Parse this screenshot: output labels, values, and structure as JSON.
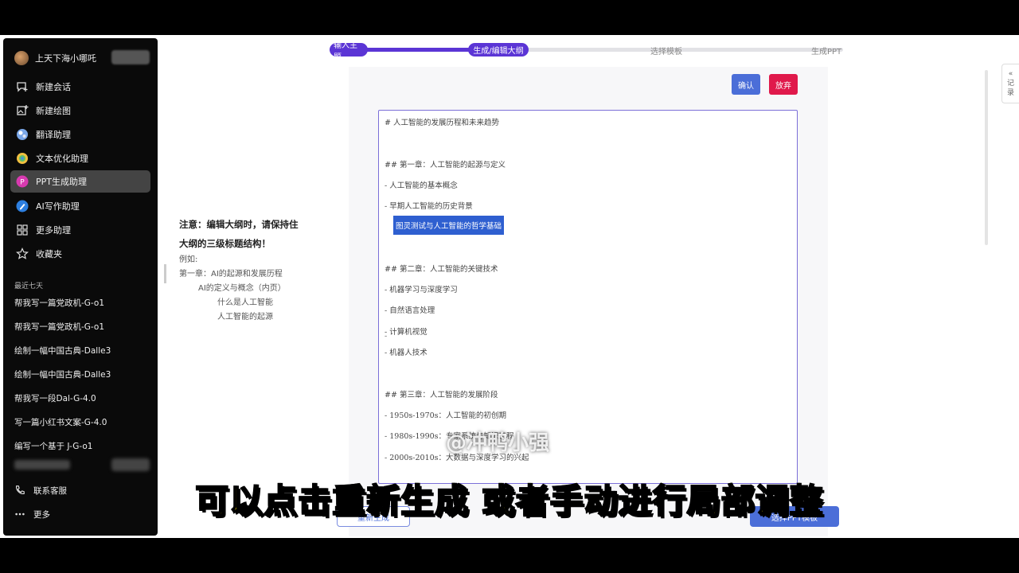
{
  "user": {
    "name": "上天下海小哪吒",
    "badge": ""
  },
  "nav": [
    {
      "label": "新建会话",
      "icon": "chat-plus-icon"
    },
    {
      "label": "新建绘图",
      "icon": "image-plus-icon"
    },
    {
      "label": "翻译助理",
      "icon": "translate-icon"
    },
    {
      "label": "文本优化助理",
      "icon": "text-optimize-icon"
    },
    {
      "label": "PPT生成助理",
      "icon": "ppt-icon"
    },
    {
      "label": "AI写作助理",
      "icon": "ai-write-icon"
    },
    {
      "label": "更多助理",
      "icon": "grid-icon"
    },
    {
      "label": "收藏夹",
      "icon": "star-icon"
    }
  ],
  "recent_label": "最近七天",
  "history": [
    "帮我写一篇党政机-G-o1",
    "帮我写一篇党政机-G-o1",
    "绘制一幅中国古典-Dalle3",
    "绘制一幅中国古典-Dalle3",
    "帮我写一段Dal-G-4.0",
    "写一篇小红书文案-G-4.0",
    "编写一个基于 J-G-o1"
  ],
  "bottom": [
    {
      "label": "联系客服",
      "icon": "phone-icon"
    },
    {
      "label": "更多",
      "icon": "more-icon"
    }
  ],
  "steps": [
    "输入主题",
    "生成/编辑大纲",
    "选择模板",
    "生成PPT"
  ],
  "hint": {
    "title1": "注意：编辑大纲时，请保持住",
    "title2": "大纲的三级标题结构！",
    "ex_label": "例如:",
    "ex1": "第一章：AI的起源和发展历程",
    "ex2": "AI的定义与概念（内页）",
    "ex3": "什么是人工智能",
    "ex4": "人工智能的起源"
  },
  "buttons": {
    "confirm": "确认",
    "discard": "放弃",
    "regenerate": "重新生成",
    "choose_template": "选择PPT模板"
  },
  "outline": {
    "l1": "# 人工智能的发展历程和未来趋势",
    "l2": "## 第一章：人工智能的起源与定义",
    "l3": "- 人工智能的基本概念",
    "l4": "- 早期人工智能的历史背景",
    "l5_prefix": "-",
    "l5": "图灵测试与人工智能的哲学基础",
    "l6": "## 第二章：人工智能的关键技术",
    "l7": "- 机器学习与深度学习",
    "l8": "- 自然语言处理",
    "l9": "- 计算机视觉",
    "l10": "- 机器人技术",
    "l11": "## 第三章：人工智能的发展阶段",
    "l12": "- 1950s-1970s：人工智能的初创期",
    "l13": "- 1980s-1990s：专家系统与知识工程",
    "l14": "- 2000s-2010s：大数据与深度学习的兴起"
  },
  "record_tab": {
    "arrow": "«",
    "c1": "记",
    "c2": "录"
  },
  "watermark": "@冲鸭小强",
  "subtitle": "可以点击重新生成 或者手动进行局部调整"
}
